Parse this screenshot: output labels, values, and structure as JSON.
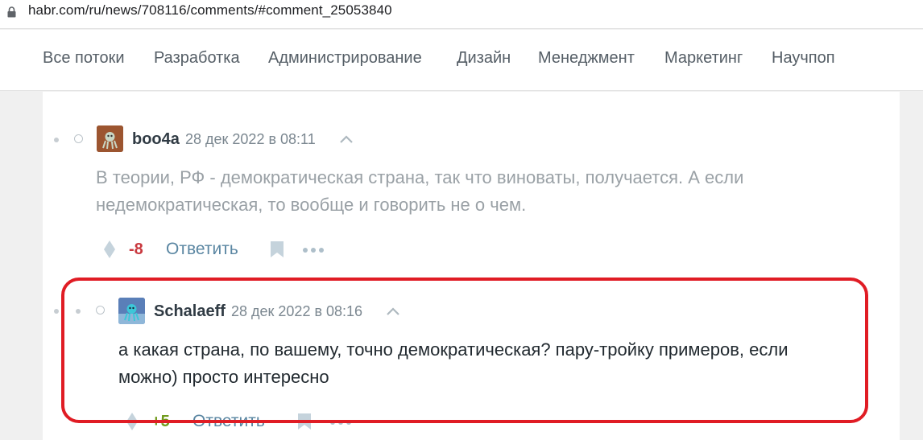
{
  "browser": {
    "url": "habr.com/ru/news/708116/comments/#comment_25053840"
  },
  "nav": {
    "items": [
      {
        "label": "Все потоки"
      },
      {
        "label": "Разработка"
      },
      {
        "label": "Администрирование"
      },
      {
        "label": "Дизайн"
      },
      {
        "label": "Менеджмент"
      },
      {
        "label": "Маркетинг"
      },
      {
        "label": "Научпоп"
      }
    ]
  },
  "comments": [
    {
      "author": "boo4a",
      "time": "28 дек 2022 в 08:11",
      "text_lines": [
        "В теории, РФ - демократическая страна, так что виноваты, получается. А если",
        "недемократическая, то вообще и говорить не о чем."
      ],
      "score": "-8",
      "reply_label": "Ответить",
      "muted": true
    },
    {
      "author": "Schalaeff",
      "time": "28 дек 2022 в 08:16",
      "text_lines": [
        "а какая страна, по вашему, точно демократическая? пару-тройку примеров, если",
        "можно) просто интересно"
      ],
      "score": "+5",
      "reply_label": "Ответить",
      "muted": false
    }
  ],
  "colors": {
    "negative_score": "#c9393f",
    "positive_score": "#6f9a1b",
    "highlight": "#e01c24",
    "link": "#5a86a2"
  }
}
